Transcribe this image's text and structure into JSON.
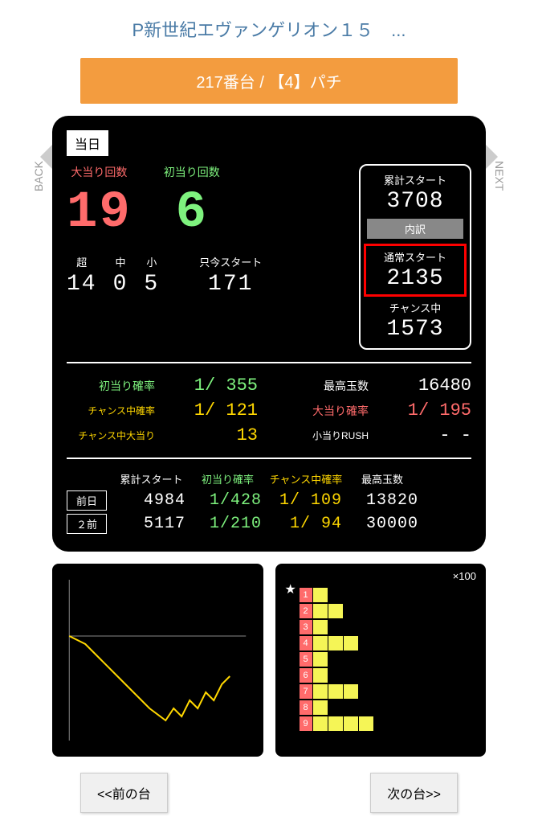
{
  "title": "P新世紀エヴァンゲリオン１５　...",
  "machine_bar": "217番台 / 【4】パチ",
  "side": {
    "back": "BACK",
    "next": "NEXT"
  },
  "today_tag": "当日",
  "big": {
    "ooatari": {
      "label": "大当り回数",
      "value": "19"
    },
    "hatsuatari": {
      "label": "初当り回数",
      "value": "6"
    }
  },
  "small": {
    "cho": {
      "label": "超",
      "value": "14"
    },
    "chu": {
      "label": "中",
      "value": "0"
    },
    "sho": {
      "label": "小",
      "value": "5"
    },
    "tadaima": {
      "label": "只今スタート",
      "value": "171"
    }
  },
  "right": {
    "ruikei": {
      "label": "累計スタート",
      "value": "3708"
    },
    "uchiwake": "内訳",
    "tsujo": {
      "label": "通常スタート",
      "value": "2135"
    },
    "chance": {
      "label": "チャンス中",
      "value": "1573"
    }
  },
  "mid": {
    "hatsu_rate": {
      "label": "初当り確率",
      "value": "1/ 355"
    },
    "chance_rate": {
      "label": "チャンス中確率",
      "value": "1/ 121"
    },
    "chance_oo": {
      "label": "チャンス中大当り",
      "value": "13"
    },
    "max_balls": {
      "label": "最高玉数",
      "value": "16480"
    },
    "oo_rate": {
      "label": "大当り確率",
      "value": "1/ 195"
    },
    "ko_rush": {
      "label": "小当りRUSH",
      "value": "- -"
    }
  },
  "hist": {
    "headers": [
      "累計スタート",
      "初当り確率",
      "チャンス中確率",
      "最高玉数"
    ],
    "rows": [
      {
        "tag": "前日",
        "vals": [
          "4984",
          "1/428",
          "1/ 109",
          "13820"
        ]
      },
      {
        "tag": "２前",
        "vals": [
          "5117",
          "1/210",
          "1/ 94",
          "30000"
        ]
      }
    ]
  },
  "x100": "×100",
  "grid_rows": [
    {
      "n": "1",
      "cells": 1
    },
    {
      "n": "2",
      "cells": 2
    },
    {
      "n": "3",
      "cells": 1
    },
    {
      "n": "4",
      "cells": 3
    },
    {
      "n": "5",
      "cells": 1
    },
    {
      "n": "6",
      "cells": 1
    },
    {
      "n": "7",
      "cells": 3
    },
    {
      "n": "8",
      "cells": 1
    },
    {
      "n": "9",
      "cells": 4
    }
  ],
  "nav": {
    "prev": "<<前の台",
    "next": "次の台>>"
  }
}
